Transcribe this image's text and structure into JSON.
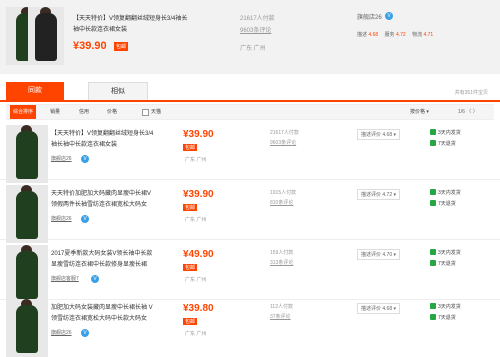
{
  "top_product": {
    "title": "【天天特价】V领复翻翻丝绒短身长3/4袖长袖中长款连衣裙女装",
    "price": "¥39.90",
    "badge": "包邮",
    "sold": "21617人付款",
    "comments": "9603条评论",
    "location": "广东 广州",
    "shop": "旗舰店26",
    "ratings": [
      {
        "label": "描述",
        "value": "4.68"
      },
      {
        "label": "服务",
        "value": "4.72"
      },
      {
        "label": "物流",
        "value": "4.71"
      }
    ]
  },
  "tabs": {
    "active": "同款",
    "inactive": "相似"
  },
  "total": "共有351件宝贝",
  "sortbar": {
    "items": [
      "综合排序",
      "销量",
      "信用",
      "价格",
      "天猫"
    ],
    "sort_select": "按价格 ▾",
    "pager": "1/6 〈 〉"
  },
  "rows": [
    {
      "title": "【天天特价】V领复翻翻丝绒短身长3/4袖长袖中长款连衣裙女装",
      "shop": "旗舰店26",
      "price": "¥39.90",
      "badge": "包邮",
      "location": "广东 广州",
      "sold": "21617人付款",
      "comments": "9603条评论",
      "rating": "描述评价 4.68 ▾",
      "guarantees": [
        "3天内发货",
        "7天退货"
      ]
    },
    {
      "title": "天天特价加肥加大码藏肉显瘦中长裙V领假两件长袖雪纺连衣裙宽松大码女",
      "shop": "旗舰店26",
      "price": "¥39.90",
      "badge": "包邮",
      "location": "广东 广州",
      "sold": "1915人付款",
      "comments": "810条评论",
      "rating": "描述评价 4.72 ▾",
      "guarantees": [
        "3天内发货",
        "7天退货"
      ]
    },
    {
      "title": "2017夏季新款大码女装V领长袖中长款显瘦雪纺连衣裙中长款修身显瘦长裙",
      "shop": "旗舰店客服7",
      "price": "¥49.90",
      "badge": "包邮",
      "location": "广东 广州",
      "sold": "159人付款",
      "comments": "313条评论",
      "rating": "描述评价 4.70 ▾",
      "guarantees": [
        "3天内发货",
        "7天退货"
      ]
    },
    {
      "title": "加肥加大码女装藏肉显瘦中长裙长袖 V领雪纺连衣裙宽松大码中长款大码女",
      "shop": "旗舰店26",
      "price": "¥39.80",
      "badge": "包邮",
      "location": "广东 广州",
      "sold": "112人付款",
      "comments": "37条评论",
      "rating": "描述评价 4.68 ▾",
      "guarantees": [
        "3天内发货",
        "7天退货"
      ]
    }
  ]
}
